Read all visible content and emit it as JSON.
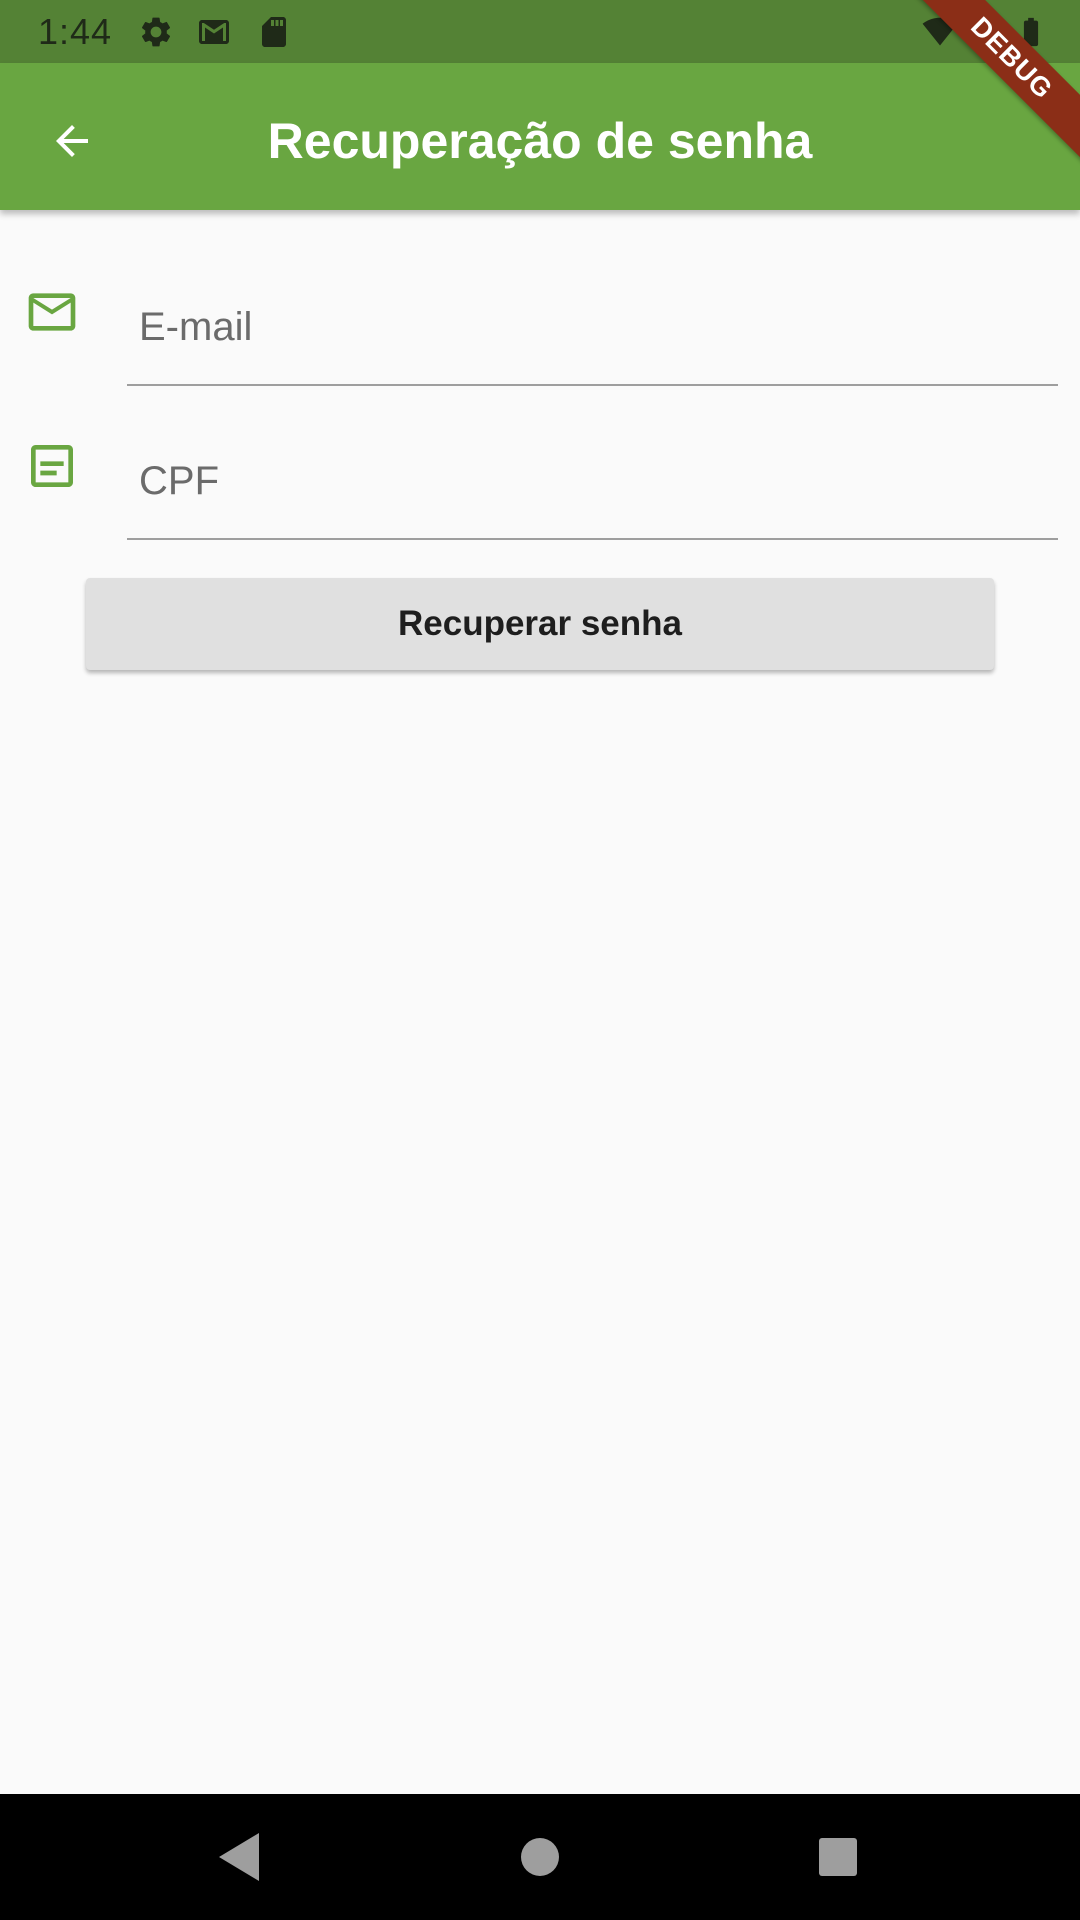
{
  "status_bar": {
    "time": "1:44",
    "background": "#548235",
    "icons": [
      "settings-icon",
      "gmail-icon",
      "sd-card-icon",
      "wifi-icon",
      "signal-icon",
      "battery-icon"
    ]
  },
  "app_bar": {
    "title": "Recuperação de senha",
    "background": "#69a641",
    "back_icon": "arrow-back-icon"
  },
  "debug_banner": {
    "label": "DEBUG",
    "color": "#8b2e17"
  },
  "form": {
    "email": {
      "placeholder": "E-mail",
      "value": "",
      "icon": "mail-icon"
    },
    "cpf": {
      "placeholder": "CPF",
      "value": "",
      "icon": "document-icon"
    },
    "submit_label": "Recuperar senha",
    "accent": "#69a641"
  },
  "nav_bar": {
    "buttons": [
      "nav-back-icon",
      "nav-home-icon",
      "nav-recents-icon"
    ]
  }
}
